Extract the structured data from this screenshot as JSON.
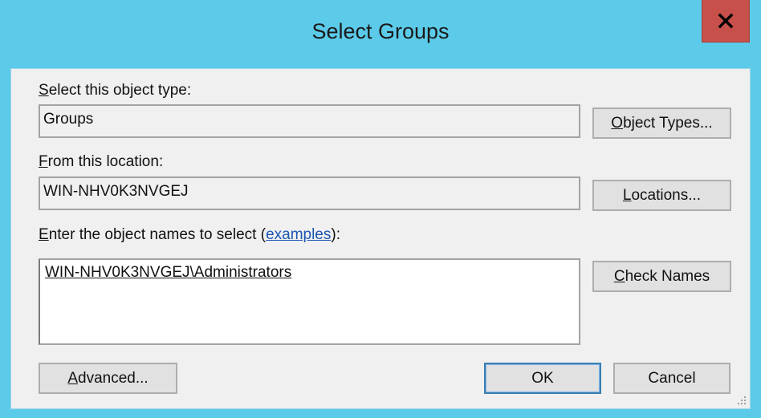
{
  "window": {
    "title": "Select Groups",
    "close_label": "x"
  },
  "object_type": {
    "label_prefix_underlined": "S",
    "label_rest": "elect this object type:",
    "value": "Groups",
    "button_underlined": "O",
    "button_rest": "bject Types..."
  },
  "location": {
    "label_prefix_underlined": "F",
    "label_rest": "rom this location:",
    "value": "WIN-NHV0K3NVGEJ",
    "button_underlined": "L",
    "button_rest": "ocations..."
  },
  "names": {
    "label_prefix_underlined": "E",
    "label_before_link": "nter the object names to select (",
    "link_text": "examples",
    "label_after_link": "):",
    "value": "WIN-NHV0K3NVGEJ\\Administrators",
    "button_underlined": "C",
    "button_rest": "heck Names"
  },
  "footer": {
    "advanced_underlined": "A",
    "advanced_rest": "dvanced...",
    "ok_label": "OK",
    "cancel_label": "Cancel"
  },
  "colors": {
    "titlebar": "#5ccbea",
    "close_button": "#c7504b",
    "dialog_bg": "#f0f0f0",
    "link": "#1a56b4",
    "default_button_border": "#3c7fb1"
  }
}
